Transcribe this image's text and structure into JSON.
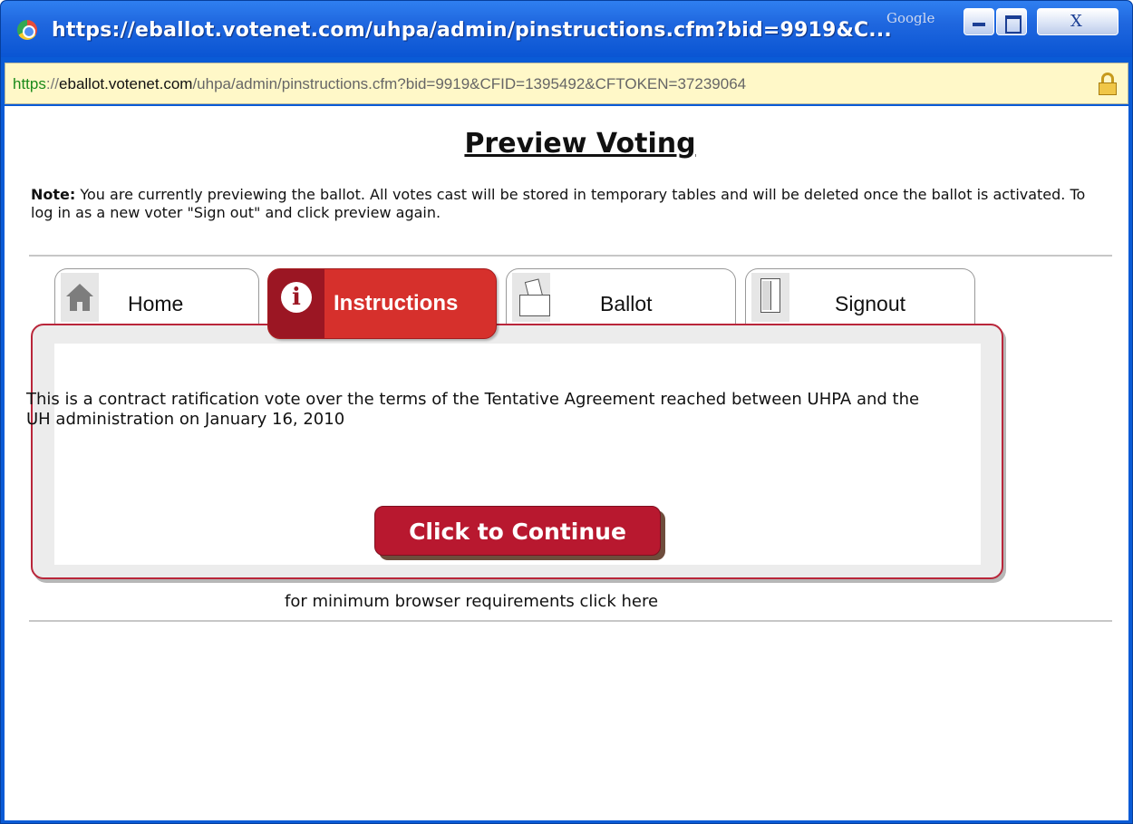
{
  "window": {
    "title": "https://eballot.votenet.com/uhpa/admin/pinstructions.cfm?bid=9919&C...",
    "search_engine_label": "Google",
    "controls": {
      "minimize": "minimize",
      "maximize": "maximize",
      "close": "close"
    }
  },
  "address_bar": {
    "scheme": "https",
    "separator": "://",
    "domain": "eballot.votenet.com",
    "path": "/uhpa/admin/pinstructions.cfm?bid=9919&CFID=1395492&CFTOKEN=37239064",
    "secure_icon": "lock-icon"
  },
  "page": {
    "title": "Preview Voting",
    "note_label": "Note:",
    "note_text": " You are currently previewing the ballot. All votes cast will be stored in temporary tables and will be deleted once the ballot is activated. To log in as a new voter \"Sign out\" and click preview again."
  },
  "tabs": [
    {
      "label": "Home",
      "icon": "home-icon",
      "active": false
    },
    {
      "label": "Instructions",
      "icon": "info-icon",
      "active": true
    },
    {
      "label": "Ballot",
      "icon": "ballot-icon",
      "active": false
    },
    {
      "label": "Signout",
      "icon": "door-icon",
      "active": false
    }
  ],
  "panel": {
    "instructions_text": "This is a contract ratification vote over the terms of the Tentative Agreement reached between UHPA and the UH administration on January 16, 2010",
    "continue_label": "Click to Continue"
  },
  "footer": {
    "browser_requirements_link": "for minimum browser requirements click here"
  },
  "colors": {
    "titlebar": "#1f67df",
    "address_bar_bg": "#fff8c8",
    "active_tab": "#d6302c",
    "brand_red": "#b8182f",
    "panel_border": "#b9263a"
  }
}
